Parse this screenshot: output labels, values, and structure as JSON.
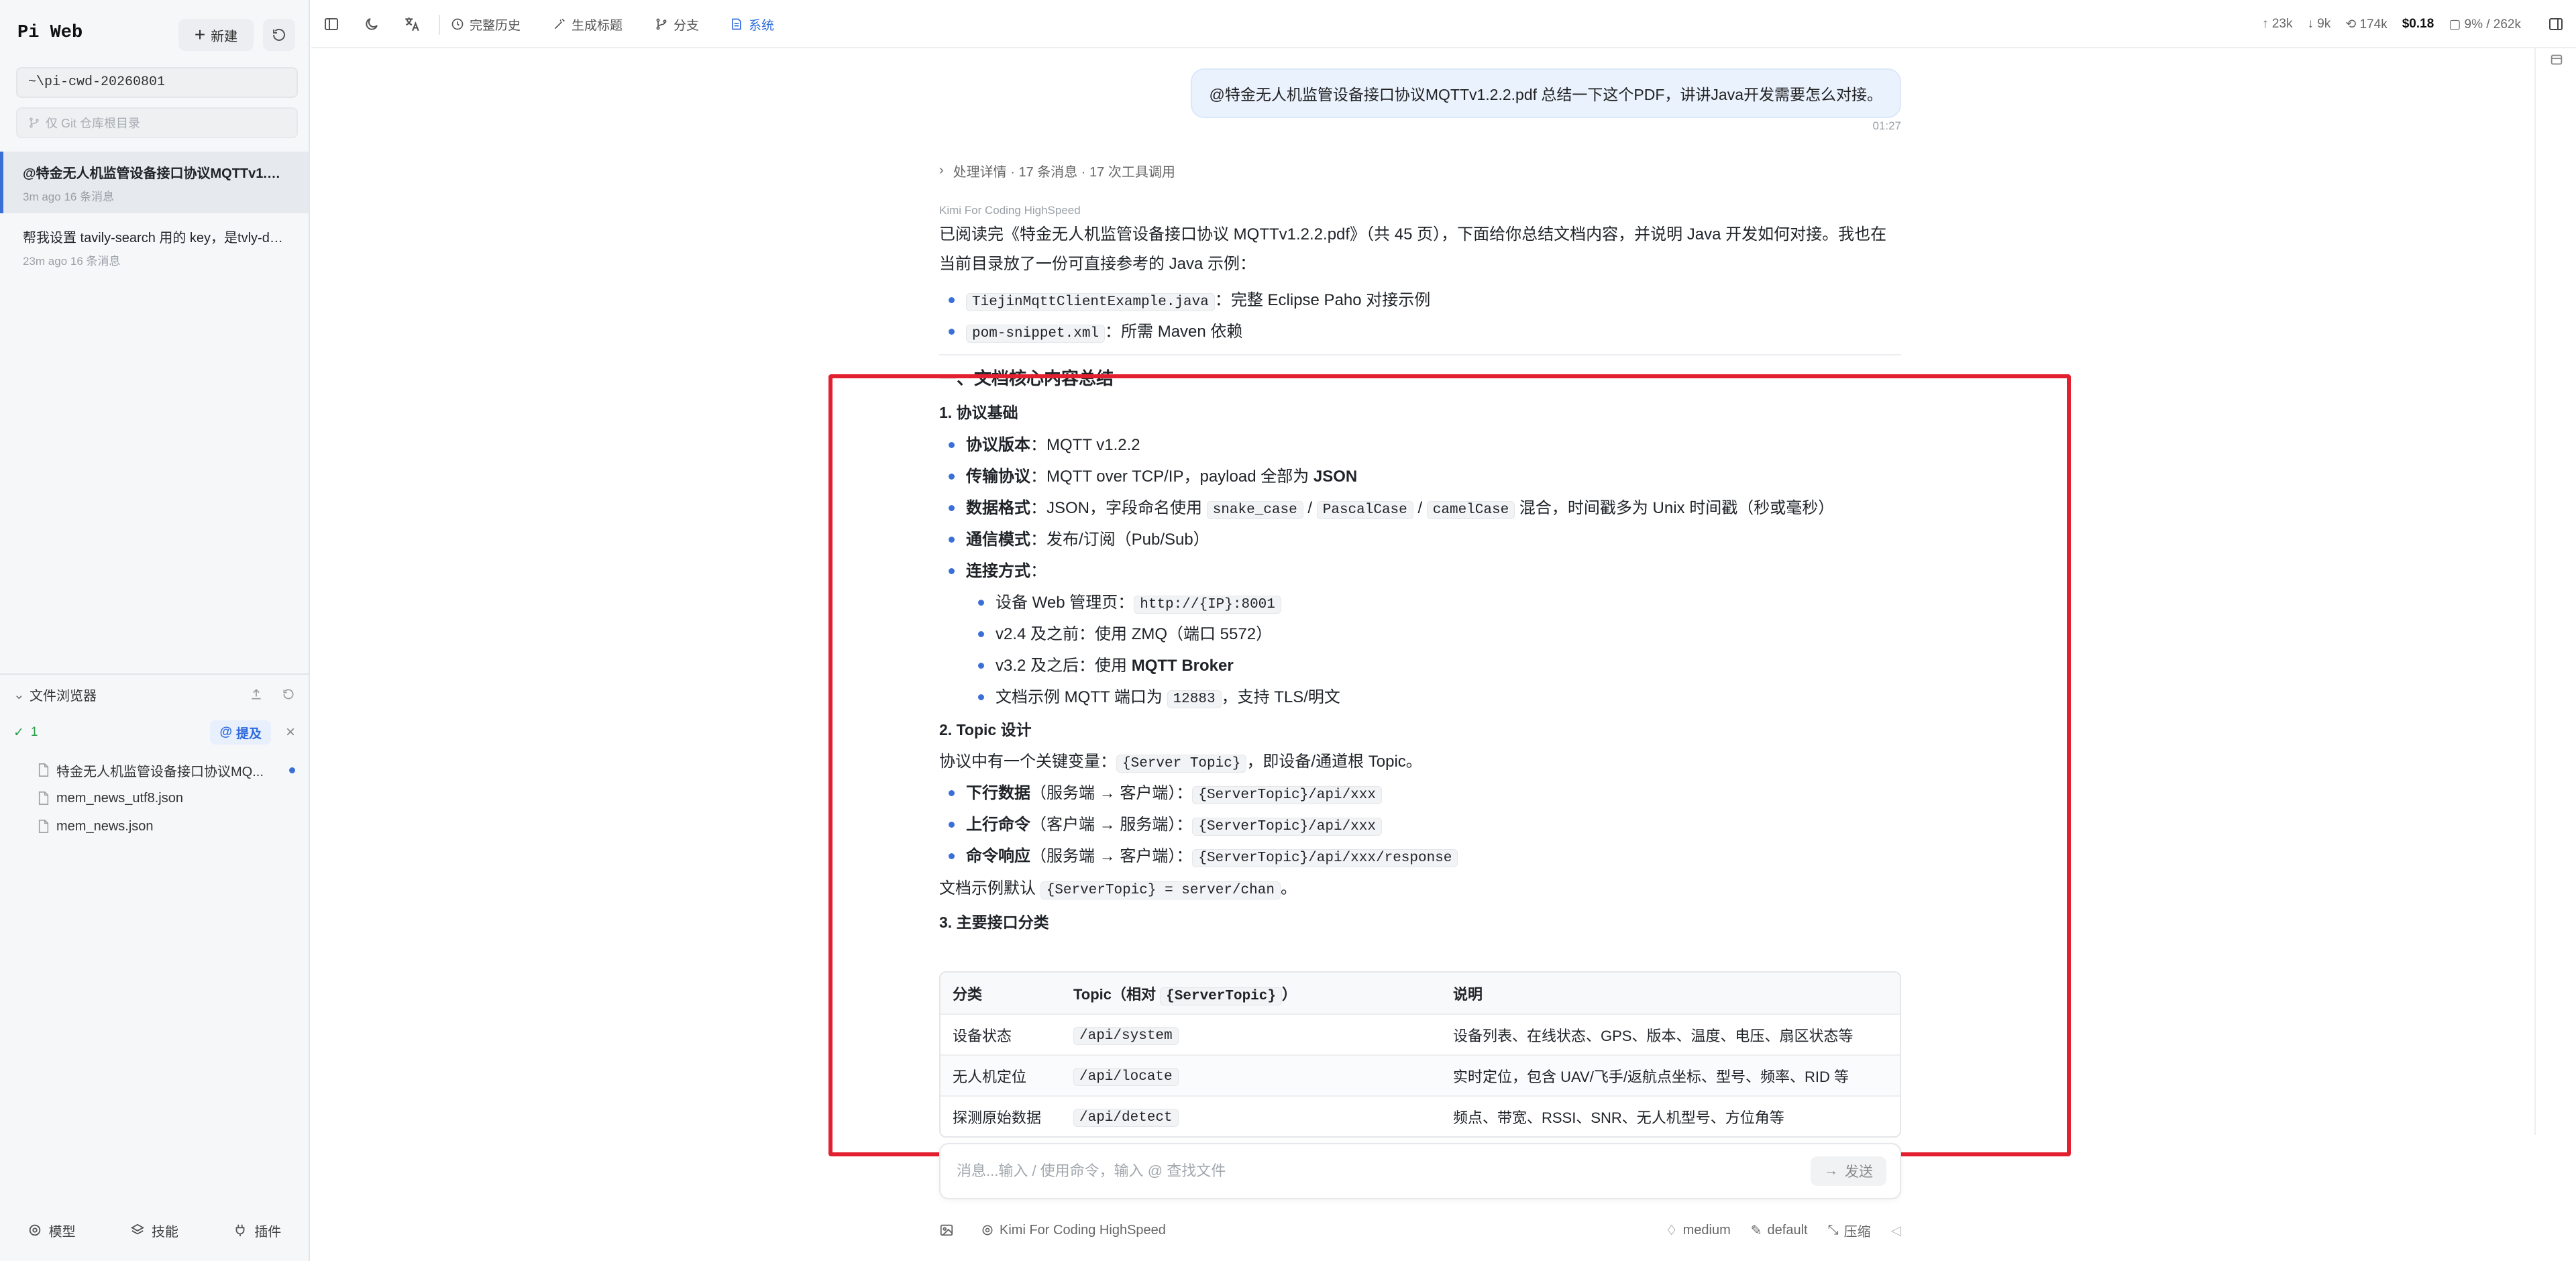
{
  "sidebar": {
    "app_title": "Pi Web",
    "new_label": "新建",
    "cwd": "~\\pi-cwd-20260801",
    "git_filter_label": "仅 Git 仓库根目录",
    "sessions": [
      {
        "title": "@特金无人机监管设备接口协议MQTTv1.2....",
        "time": "3m ago",
        "count": "16 条消息"
      },
      {
        "title": "帮我设置 tavily-search 用的 key，是tvly-de...",
        "time": "23m ago",
        "count": "16 条消息"
      }
    ],
    "file_browser": {
      "title": "文件浏览器",
      "status_count": "1",
      "mention_label": "提及",
      "files": [
        {
          "name": "特金无人机监管设备接口协议MQ...",
          "modified": true
        },
        {
          "name": "mem_news_utf8.json",
          "modified": false
        },
        {
          "name": "mem_news.json",
          "modified": false
        }
      ]
    },
    "bottom": {
      "model": "模型",
      "skills": "技能",
      "plugins": "插件"
    }
  },
  "toolbar": {
    "history": "完整历史",
    "gen_title": "生成标题",
    "branch": "分支",
    "system": "系统",
    "stats": {
      "up": "23k",
      "down": "9k",
      "cache": "174k",
      "cost": "$0.18",
      "context": "9% / 262k"
    }
  },
  "chat": {
    "user_message": "@特金无人机监管设备接口协议MQTTv1.2.2.pdf 总结一下这个PDF，讲讲Java开发需要怎么对接。",
    "user_time": "01:27",
    "details": "处理详情 · 17 条消息 · 17 次工具调用",
    "model_tag": "Kimi For Coding HighSpeed",
    "intro_line1": "已阅读完《特金无人机监管设备接口协议 MQTTv1.2.2.pdf》（共 45 页），下面给你总结文档内容，并说明 Java 开发如何对接。我也在",
    "intro_line2": "当前目录放了一份可直接参考的 Java 示例：",
    "example_files": [
      {
        "code": "TiejinMqttClientExample.java",
        "desc": "：完整 Eclipse Paho 对接示例"
      },
      {
        "code": "pom-snippet.xml",
        "desc": "：所需 Maven 依赖"
      }
    ],
    "h_summary": "一、文档核心内容总结",
    "s1": {
      "title": "1. 协议基础",
      "version_k": "协议版本",
      "version_v": "MQTT v1.2.2",
      "transport_k": "传输协议",
      "transport_v": "MQTT over TCP/IP，payload 全部为 ",
      "transport_b": "JSON",
      "format_k": "数据格式",
      "format_v1": "JSON，字段命名使用 ",
      "format_c1": "snake_case",
      "slash": "/",
      "format_c2": "PascalCase",
      "format_c3": "camelCase",
      "format_v2": " 混合，时间戳多为 Unix 时间戳（秒或毫秒）",
      "mode_k": "通信模式",
      "mode_v": "发布/订阅（Pub/Sub）",
      "conn_k": "连接方式",
      "conn_web": "设备 Web 管理页：",
      "conn_web_code": "http://{IP}:8001",
      "conn_old": "v2.4 及之前：使用 ZMQ（端口 5572）",
      "conn_new": "v3.2 及之后：使用 ",
      "conn_new_b": "MQTT Broker",
      "conn_port1": "文档示例 MQTT 端口为 ",
      "conn_port_code": "12883",
      "conn_port2": "，支持 TLS/明文",
      "colon": "："
    },
    "s2": {
      "title": "2. Topic 设计",
      "intro1": "协议中有一个关键变量：",
      "intro_code": "{Server Topic}",
      "intro2": "，即设备/通道根 Topic。",
      "down_k": "下行数据",
      "down_v": "（服务端 → 客户端）：",
      "down_code": "{ServerTopic}/api/xxx",
      "up_k": "上行命令",
      "up_v": "（客户端 → 服务端）：",
      "up_code": "{ServerTopic}/api/xxx",
      "resp_k": "命令响应",
      "resp_v": "（服务端 → 客户端）：",
      "resp_code": "{ServerTopic}/api/xxx/response",
      "default1": "文档示例默认 ",
      "default_code": "{ServerTopic} = server/chan",
      "default2": "。"
    },
    "s3": {
      "title": "3. 主要接口分类",
      "headers": {
        "c1": "分类",
        "c2a": "Topic（相对 ",
        "c2code": "{ServerTopic}",
        "c2b": "）",
        "c3": "说明"
      },
      "rows": [
        {
          "cat": "设备状态",
          "topic": "/api/system",
          "desc": "设备列表、在线状态、GPS、版本、温度、电压、扇区状态等"
        },
        {
          "cat": "无人机定位",
          "topic": "/api/locate",
          "desc": "实时定位，包含 UAV/飞手/返航点坐标、型号、频率、RID 等"
        },
        {
          "cat": "探测原始数据",
          "topic": "/api/detect",
          "desc": "频点、带宽、RSSI、SNR、无人机型号、方位角等"
        }
      ]
    }
  },
  "composer": {
    "placeholder": "消息...输入 / 使用命令，输入 @ 查找文件",
    "send": "发送",
    "model": "Kimi For Coding HighSpeed",
    "thinking": "medium",
    "profile": "default",
    "compress": "压缩"
  },
  "colors": {
    "accent": "#3b6fd8",
    "highlight": "#e3202f",
    "user_bubble": "#eaf2fe"
  }
}
